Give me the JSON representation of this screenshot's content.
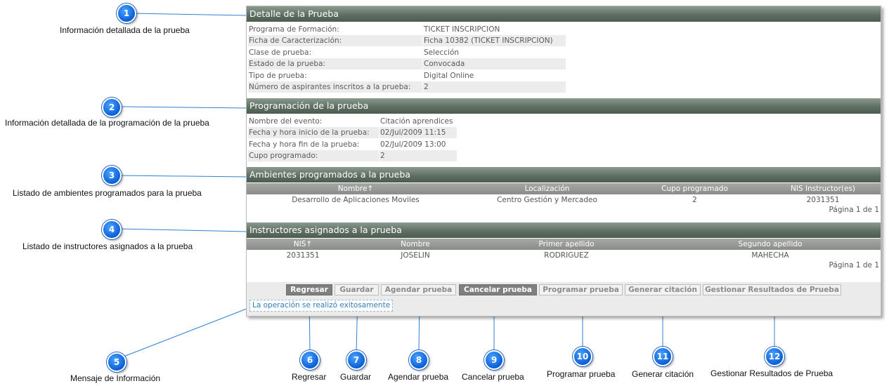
{
  "detalle": {
    "title": "Detalle de la Prueba",
    "rows": [
      {
        "label": "Programa de Formación:",
        "value": "TICKET INSCRIPCION"
      },
      {
        "label": "Ficha de Caracterización:",
        "value": "Ficha 10382 (TICKET INSCRIPCION)"
      },
      {
        "label": "Clase de prueba:",
        "value": "Selección"
      },
      {
        "label": "Estado de la prueba:",
        "value": "Convocada"
      },
      {
        "label": "Tipo de prueba:",
        "value": "Digital Online"
      },
      {
        "label": "Número de aspirantes inscritos a la prueba:",
        "value": "2"
      }
    ]
  },
  "programacion": {
    "title": "Programación de la prueba",
    "rows": [
      {
        "label": "Nombre del evento:",
        "value": "Citación aprendices"
      },
      {
        "label": "Fecha y hora inicio de la prueba:",
        "value": "02/Jul/2009 11:15"
      },
      {
        "label": "Fecha y hora fin de la prueba:",
        "value": "02/Jul/2009 13:00"
      },
      {
        "label": "Cupo programado:",
        "value": "2"
      }
    ]
  },
  "ambientes": {
    "title": "Ambientes programados a la prueba",
    "columns": [
      "Nombre↑",
      "Localización",
      "Cupo programado",
      "NIS Instructor(es)"
    ],
    "rows": [
      [
        "Desarrollo de Aplicaciones Moviles",
        "Centro Gestión y Mercadeo",
        "2",
        "2031351"
      ]
    ],
    "pager": "Página 1 de 1"
  },
  "instructores": {
    "title": "Instructores asignados a la prueba",
    "columns": [
      "NIS↑",
      "Nombre",
      "Primer apellido",
      "Segundo apellido"
    ],
    "rows": [
      [
        "2031351",
        "JOSELIN",
        "RODRIGUEZ",
        "MAHECHA"
      ]
    ],
    "pager": "Página 1 de 1"
  },
  "buttons": {
    "regresar": "Regresar",
    "guardar": "Guardar",
    "agendar": "Agendar prueba",
    "cancelar": "Cancelar prueba",
    "programar": "Programar prueba",
    "generar": "Generar citación",
    "gestionar": "Gestionar Resultados de Prueba"
  },
  "message": "La operación se realizó exitosamente",
  "callouts": [
    {
      "num": "1",
      "caption": "Información detallada de la prueba"
    },
    {
      "num": "2",
      "caption": "Información detallada de la programación de la prueba"
    },
    {
      "num": "3",
      "caption": "Listado de ambientes programados para la prueba"
    },
    {
      "num": "4",
      "caption": "Listado de instructores asignados a la prueba"
    },
    {
      "num": "5",
      "caption": "Mensaje de Información"
    },
    {
      "num": "6",
      "caption": "Regresar"
    },
    {
      "num": "7",
      "caption": "Guardar"
    },
    {
      "num": "8",
      "caption": "Agendar prueba"
    },
    {
      "num": "9",
      "caption": "Cancelar prueba"
    },
    {
      "num": "10",
      "caption": "Programar prueba"
    },
    {
      "num": "11",
      "caption": "Generar citación"
    },
    {
      "num": "12",
      "caption": "Gestionar Resultados de Prueba"
    }
  ],
  "colors": {
    "header": "#5f6f63",
    "callout": "#0a5fd6",
    "message": "#3a7fb5"
  }
}
